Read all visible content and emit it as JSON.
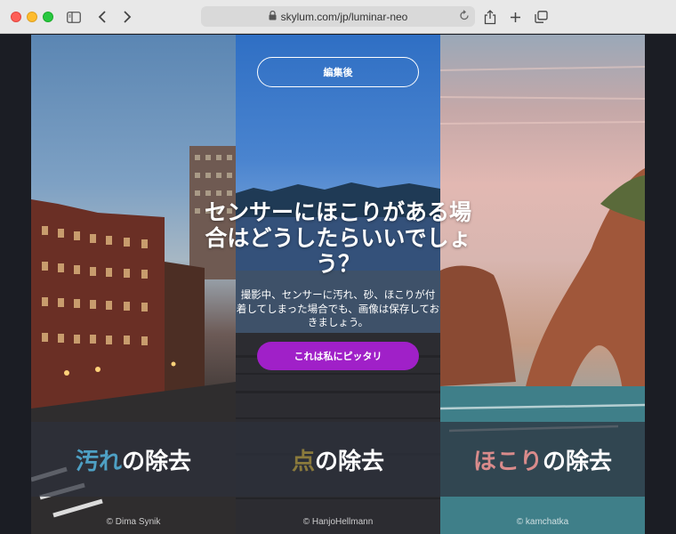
{
  "browser": {
    "url": "skylum.com/jp/luminar-neo",
    "icons": {
      "sidebar": "sidebar-icon",
      "back": "chevron-left-icon",
      "forward": "chevron-right-icon",
      "lock": "lock-icon",
      "reload": "reload-icon",
      "share": "share-icon",
      "new_tab": "plus-icon",
      "tabs": "tabs-overview-icon"
    }
  },
  "hero": {
    "after_button": "編集後",
    "headline": "センサーにほこりがある場合はどうしたらいいでしょう？",
    "subtext": "撮影中、センサーに汚れ、砂、ほこりが付着してしまった場合でも、画像は保存しておきましょう。",
    "cta": "これは私にピッタリ"
  },
  "panels": [
    {
      "accent": "汚れ",
      "rest": "の除去",
      "credit": "© Dima Synik",
      "accent_color": "#4ea0c4"
    },
    {
      "accent": "点",
      "rest": "の除去",
      "credit": "© HanjoHellmann",
      "accent_color": "#8a7a3c"
    },
    {
      "accent": "ほこり",
      "rest": "の除去",
      "credit": "© kamchatka",
      "accent_color": "#d98b8b"
    }
  ]
}
